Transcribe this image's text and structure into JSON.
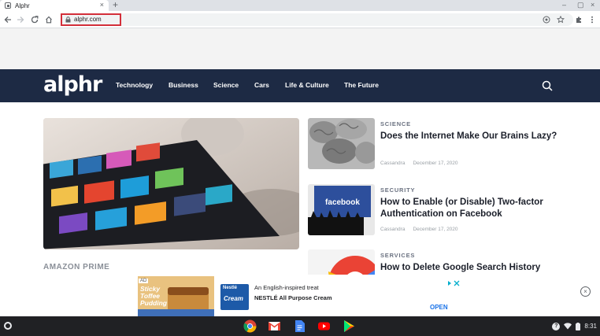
{
  "browser": {
    "tab_title": "Alphr",
    "tab_close": "×",
    "new_tab": "+",
    "window_controls": [
      "–",
      "▢",
      "×"
    ],
    "url": "alphr.com",
    "icons": [
      "back-icon",
      "forward-icon",
      "reload-icon",
      "home-icon",
      "lock-icon",
      "install-icon",
      "bookmark-star-icon",
      "extensions-icon",
      "menu-icon"
    ],
    "highlight_color": "#d32f3a"
  },
  "site": {
    "logo": "alphr",
    "nav_color": "#1d2a44",
    "nav": [
      "Technology",
      "Business",
      "Science",
      "Cars",
      "Life & Culture",
      "The Future"
    ]
  },
  "main": {
    "hero_category": "AMAZON PRIME",
    "articles": [
      {
        "category": "SCIENCE",
        "title": "Does the Internet Make Our Brains Lazy?",
        "author": "Cassandra",
        "date": "December 17, 2020"
      },
      {
        "category": "SECURITY",
        "title": "How to Enable (or Disable) Two-factor Authentication on Facebook",
        "author": "Cassandra",
        "date": "December 17, 2020"
      },
      {
        "category": "SERVICES",
        "title": "How to Delete Google Search History",
        "author": "",
        "date": ""
      }
    ],
    "thumb_text": {
      "facebook": "facebook"
    }
  },
  "ad": {
    "badge": "AD",
    "image_text": "Sticky Toffee Pudding",
    "logo_text": "Nestlé",
    "logo_sub": "Cream",
    "line1": "An English-inspired treat",
    "line2": "NESTLÉ All Purpose Cream",
    "cta": "OPEN",
    "close": "×"
  },
  "shelf": {
    "apps": [
      "chrome-icon",
      "gmail-icon",
      "docs-icon",
      "youtube-icon",
      "play-store-icon"
    ],
    "time": "8:31",
    "help": "?"
  }
}
